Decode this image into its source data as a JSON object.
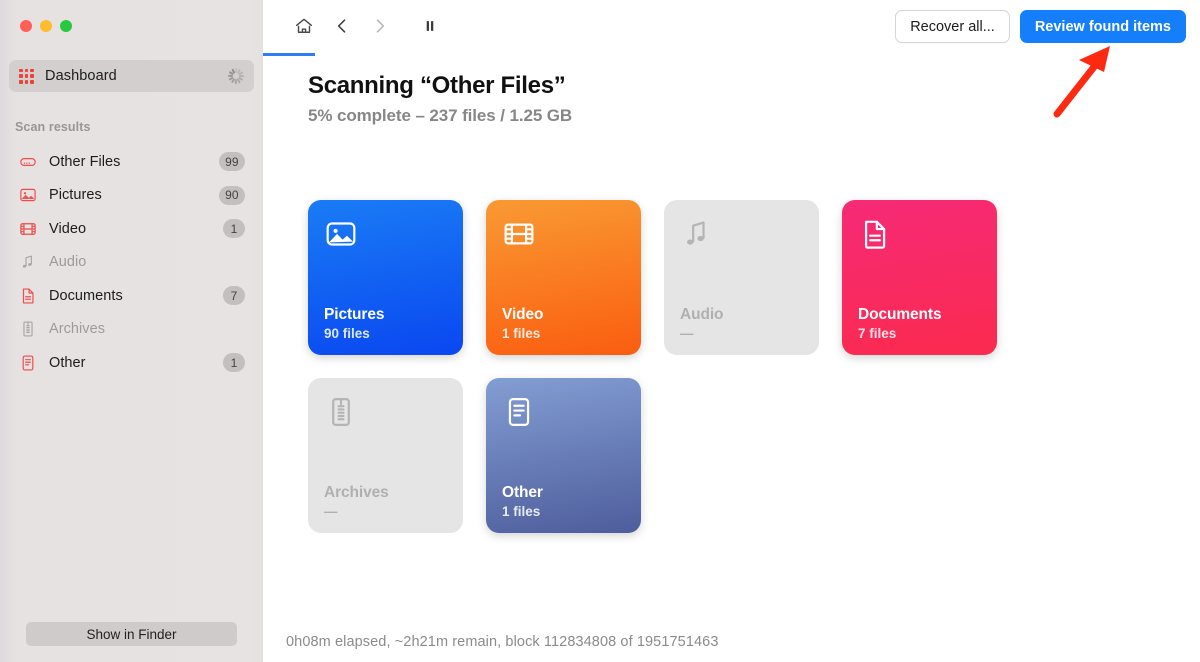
{
  "window": {
    "traffic_lights": [
      {
        "name": "close",
        "color": "#ff5f57"
      },
      {
        "name": "minimize",
        "color": "#febc2e"
      },
      {
        "name": "zoom",
        "color": "#28c840"
      }
    ]
  },
  "sidebar": {
    "dashboard": {
      "label": "Dashboard",
      "icon": "grid-icon",
      "busy_icon": "spinner-icon"
    },
    "section_label": "Scan results",
    "items": [
      {
        "label": "Other Files",
        "badge": "99",
        "icon": "drive-icon",
        "color": "#ef4b4b",
        "dimmed": false
      },
      {
        "label": "Pictures",
        "badge": "90",
        "icon": "picture-icon",
        "color": "#ef4b4b",
        "dimmed": false
      },
      {
        "label": "Video",
        "badge": "1",
        "icon": "film-icon",
        "color": "#ef4b4b",
        "dimmed": false
      },
      {
        "label": "Audio",
        "badge": "",
        "icon": "music-icon",
        "color": "#a9a5a5",
        "dimmed": true
      },
      {
        "label": "Documents",
        "badge": "7",
        "icon": "document-icon",
        "color": "#ef4b4b",
        "dimmed": false
      },
      {
        "label": "Archives",
        "badge": "",
        "icon": "zip-icon",
        "color": "#a9a5a5",
        "dimmed": true
      },
      {
        "label": "Other",
        "badge": "1",
        "icon": "list-doc-icon",
        "color": "#ef4b4b",
        "dimmed": false
      }
    ],
    "show_in_finder_label": "Show in Finder"
  },
  "toolbar": {
    "home_icon": "home-icon",
    "back_icon": "chevron-left-icon",
    "forward_icon": "chevron-right-icon",
    "pause_icon": "pause-icon",
    "active_tab": "home",
    "accent_color": "#2f7cf6",
    "recover_all_label": "Recover all...",
    "review_found_items_label": "Review found items"
  },
  "main": {
    "title": "Scanning “Other Files”",
    "subtitle": "5% complete – 237 files / 1.25 GB",
    "status": "0h08m elapsed, ~2h21m remain, block 112834808 of 1951751463"
  },
  "tiles": [
    {
      "name": "Pictures",
      "count": "90 files",
      "icon": "picture-icon",
      "disabled": false,
      "grad_top": "#1a7cf5",
      "grad_bottom": "#0a47f0"
    },
    {
      "name": "Video",
      "count": "1 files",
      "icon": "film-icon",
      "disabled": false,
      "grad_top": "#f99a33",
      "grad_bottom": "#fa5d10"
    },
    {
      "name": "Audio",
      "count": "—",
      "icon": "music-icon",
      "disabled": true,
      "grad_top": "#e6e5e5",
      "grad_bottom": "#e6e5e5"
    },
    {
      "name": "Documents",
      "count": "7 files",
      "icon": "document-icon",
      "disabled": false,
      "grad_top": "#f62a77",
      "grad_bottom": "#fb2a4e"
    },
    {
      "name": "Archives",
      "count": "—",
      "icon": "zip-icon",
      "disabled": true,
      "grad_top": "#e6e5e5",
      "grad_bottom": "#e6e5e5"
    },
    {
      "name": "Other",
      "count": "1 files",
      "icon": "list-doc-icon",
      "disabled": false,
      "grad_top": "#839ed3",
      "grad_bottom": "#4e5d9c"
    }
  ],
  "annotation": {
    "arrow_color": "#fc2a10",
    "points_to": "review-found-items-button"
  }
}
